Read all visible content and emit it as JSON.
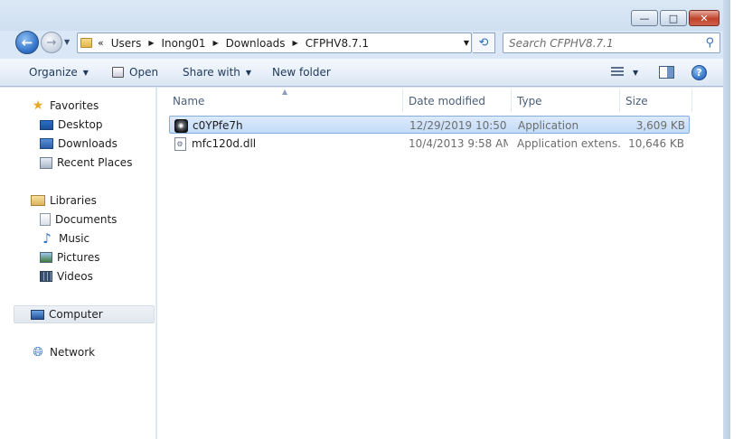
{
  "window": {
    "controls": {
      "minimize": "—",
      "maximize": "□",
      "close": "✕"
    }
  },
  "nav": {
    "back_icon": "back-arrow-icon",
    "forward_icon": "forward-arrow-icon",
    "breadcrumb": [
      "Users",
      "Inong01",
      "Downloads",
      "CFPHV8.7.1"
    ],
    "chevron": "«",
    "search_placeholder": "Search CFPHV8.7.1"
  },
  "toolbar": {
    "organize": "Organize",
    "open": "Open",
    "share_with": "Share with",
    "new_folder": "New folder"
  },
  "sidebar": {
    "favorites": {
      "label": "Favorites",
      "items": [
        "Desktop",
        "Downloads",
        "Recent Places"
      ]
    },
    "libraries": {
      "label": "Libraries",
      "items": [
        "Documents",
        "Music",
        "Pictures",
        "Videos"
      ]
    },
    "computer": "Computer",
    "network": "Network"
  },
  "columns": {
    "name": "Name",
    "date": "Date modified",
    "type": "Type",
    "size": "Size"
  },
  "files": [
    {
      "name": "c0YPfe7h",
      "date": "12/29/2019 10:50 ...",
      "type": "Application",
      "size": "3,609 KB",
      "selected": true,
      "icon": "application-icon"
    },
    {
      "name": "mfc120d.dll",
      "date": "10/4/2013 9:58 AM",
      "type": "Application extens...",
      "size": "10,646 KB",
      "selected": false,
      "icon": "dll-file-icon"
    }
  ]
}
